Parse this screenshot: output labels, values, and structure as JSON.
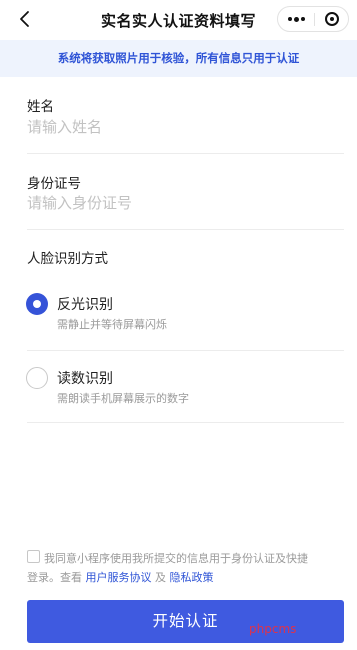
{
  "navbar": {
    "title": "实名实人认证资料填写",
    "back_icon": "chevron-left-icon",
    "more_icon": "more-dots-icon",
    "close_icon": "target-close-icon"
  },
  "notice": {
    "text": "系统将获取照片用于核验，所有信息只用于认证"
  },
  "form": {
    "name_label": "姓名",
    "name_placeholder": "请输入姓名",
    "name_value": "",
    "id_label": "身份证号",
    "id_placeholder": "请输入身份证号",
    "id_value": ""
  },
  "face_method": {
    "title": "人脸识别方式",
    "options": [
      {
        "title": "反光识别",
        "desc": "需静止并等待屏幕闪烁",
        "selected": true
      },
      {
        "title": "读数识别",
        "desc": "需朗读手机屏幕展示的数字",
        "selected": false
      }
    ]
  },
  "agreement": {
    "checked": false,
    "line1": "我同意小程序使用我所提交的信息用于身份认证及快捷",
    "line2_prefix": "登录。查看",
    "user_agreement": "用户服务协议",
    "and": "及",
    "privacy_policy": "隐私政策"
  },
  "start_button": {
    "label": "开始认证"
  },
  "watermark": {
    "text": "phpcms"
  },
  "colors": {
    "accent": "#3f5ae0",
    "link": "#2f54d6",
    "notice_bg": "#eef3fd",
    "watermark": "#e0324a"
  }
}
